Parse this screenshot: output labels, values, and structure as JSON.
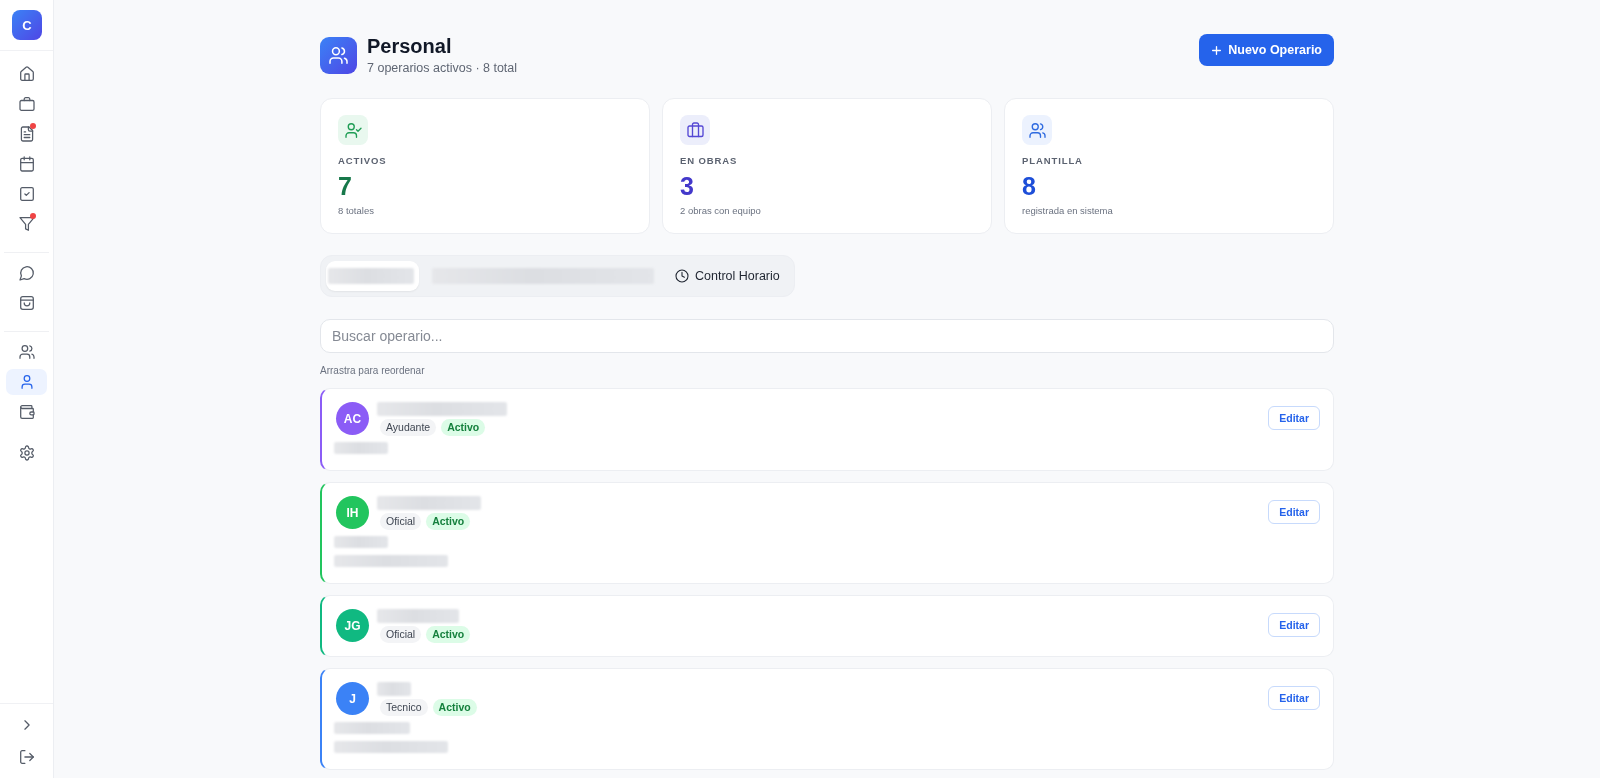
{
  "sidebar": {
    "logo": "C",
    "groups": [
      {
        "separator": false,
        "items": [
          {
            "kind": "home",
            "selected": false,
            "badge": false
          },
          {
            "kind": "briefcase",
            "selected": false,
            "badge": false
          },
          {
            "kind": "document",
            "selected": false,
            "badge": true
          },
          {
            "kind": "calendar",
            "selected": false,
            "badge": false
          },
          {
            "kind": "checklist",
            "selected": false,
            "badge": false
          },
          {
            "kind": "filter",
            "selected": false,
            "badge": true
          }
        ]
      },
      {
        "separator": true,
        "items": [
          {
            "kind": "chat",
            "selected": false,
            "badge": false
          },
          {
            "kind": "bag",
            "selected": false,
            "badge": false
          }
        ]
      },
      {
        "separator": true,
        "items": [
          {
            "kind": "users",
            "selected": false,
            "badge": false
          },
          {
            "kind": "user",
            "selected": true,
            "badge": false
          },
          {
            "kind": "wallet",
            "selected": false,
            "badge": false
          }
        ]
      },
      {
        "separator": false,
        "items": [
          {
            "kind": "settings",
            "selected": false,
            "badge": false
          }
        ]
      }
    ],
    "footer": [
      {
        "kind": "expand"
      },
      {
        "kind": "logout"
      }
    ]
  },
  "header": {
    "title": "Personal",
    "subtitle": "7 operarios activos · 8 total",
    "primary_action": "Nuevo Operario"
  },
  "stats": [
    {
      "kind": "active",
      "label": "ACTIVOS",
      "value": "7",
      "caption": "8 totales"
    },
    {
      "kind": "sites",
      "label": "EN OBRAS",
      "value": "3",
      "caption": "2 obras con equipo"
    },
    {
      "kind": "staff",
      "label": "PLANTILLA",
      "value": "8",
      "caption": "registrada en sistema"
    }
  ],
  "tabs": [
    {
      "kind": "redacted",
      "selected": true
    },
    {
      "kind": "redacted",
      "selected": false
    },
    {
      "kind": "labeled",
      "label": "Control Horario",
      "selected": false
    }
  ],
  "search": {
    "placeholder": "Buscar operario..."
  },
  "drag_hint": "Arrastra para reordenar",
  "operators": [
    {
      "initials": "AC",
      "color": "#8b5cf6",
      "role": "Ayudante",
      "status": "Activo",
      "details": [
        {
          "kind": "short"
        }
      ],
      "action": "Editar"
    },
    {
      "initials": "IH",
      "color": "#22c55e",
      "role": "Oficial",
      "status": "Activo",
      "details": [
        {
          "kind": "short"
        },
        {
          "kind": "long"
        }
      ],
      "action": "Editar"
    },
    {
      "initials": "JG",
      "color": "#10b981",
      "role": "Oficial",
      "status": "Activo",
      "action": "Editar"
    },
    {
      "initials": "J",
      "color": "#3b82f6",
      "role": "Tecnico",
      "status": "Activo",
      "details": [
        {
          "kind": "medium"
        },
        {
          "kind": "long"
        }
      ],
      "action": "Editar"
    }
  ]
}
